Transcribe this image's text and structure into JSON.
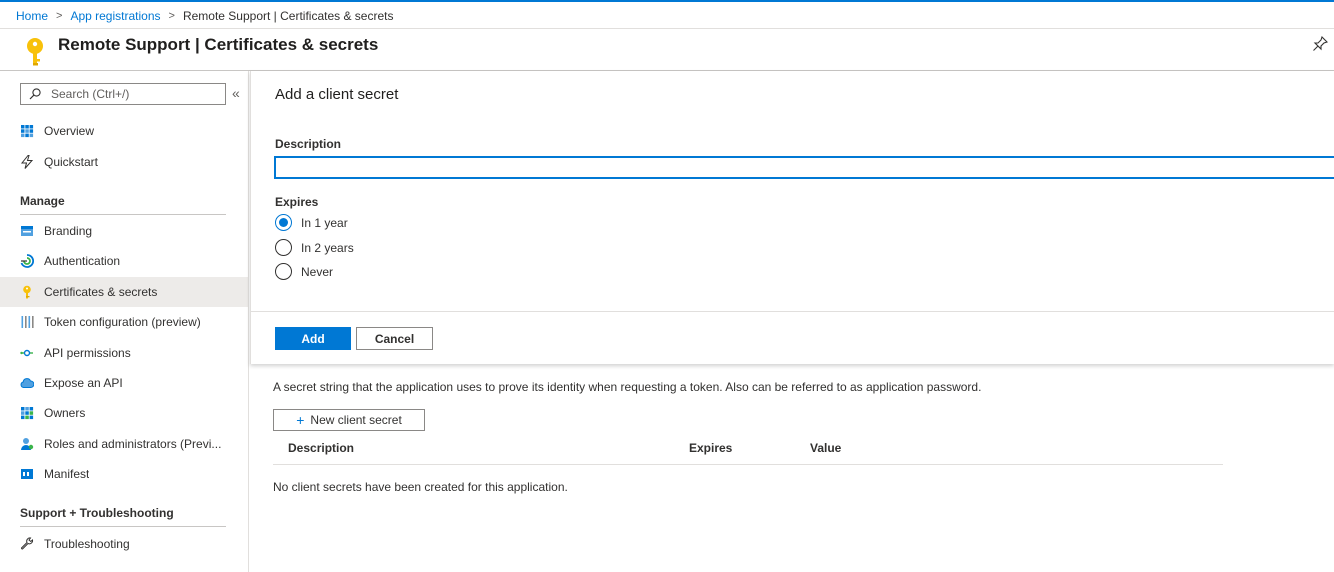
{
  "breadcrumb": {
    "home": "Home",
    "app_registrations": "App registrations",
    "current": "Remote Support | Certificates & secrets",
    "separator": ">"
  },
  "header": {
    "title": "Remote Support | Certificates & secrets",
    "icon": "key-icon",
    "pin_icon": "pin-icon"
  },
  "sidebar": {
    "search_placeholder": "Search (Ctrl+/)",
    "collapse_glyph": "«",
    "top_items": [
      {
        "label": "Overview",
        "icon": "overview-grid-icon"
      },
      {
        "label": "Quickstart",
        "icon": "lightning-icon"
      }
    ],
    "manage_title": "Manage",
    "manage_items": [
      {
        "label": "Branding",
        "icon": "branding-icon"
      },
      {
        "label": "Authentication",
        "icon": "authentication-icon"
      },
      {
        "label": "Certificates & secrets",
        "icon": "key-icon",
        "selected": true
      },
      {
        "label": "Token configuration (preview)",
        "icon": "token-bars-icon"
      },
      {
        "label": "API permissions",
        "icon": "api-permissions-icon"
      },
      {
        "label": "Expose an API",
        "icon": "cloud-icon"
      },
      {
        "label": "Owners",
        "icon": "owners-grid-icon"
      },
      {
        "label": "Roles and administrators (Previ...",
        "icon": "roles-user-icon"
      },
      {
        "label": "Manifest",
        "icon": "manifest-icon"
      }
    ],
    "support_title": "Support + Troubleshooting",
    "support_items": [
      {
        "label": "Troubleshooting",
        "icon": "wrench-icon"
      }
    ]
  },
  "panel": {
    "title": "Add a client secret",
    "description_label": "Description",
    "description_value": "",
    "expires_label": "Expires",
    "expires_options": [
      {
        "label": "In 1 year",
        "selected": true
      },
      {
        "label": "In 2 years",
        "selected": false
      },
      {
        "label": "Never",
        "selected": false
      }
    ],
    "add_label": "Add",
    "cancel_label": "Cancel"
  },
  "secrets": {
    "description": "A secret string that the application uses to prove its identity when requesting a token. Also can be referred to as application password.",
    "new_button_label": "New client secret",
    "columns": [
      "Description",
      "Expires",
      "Value"
    ],
    "empty_message": "No client secrets have been created for this application."
  },
  "colors": {
    "accent": "#0078d4",
    "key_yellow": "#f8c10a",
    "selected_bg": "#edebe9"
  }
}
